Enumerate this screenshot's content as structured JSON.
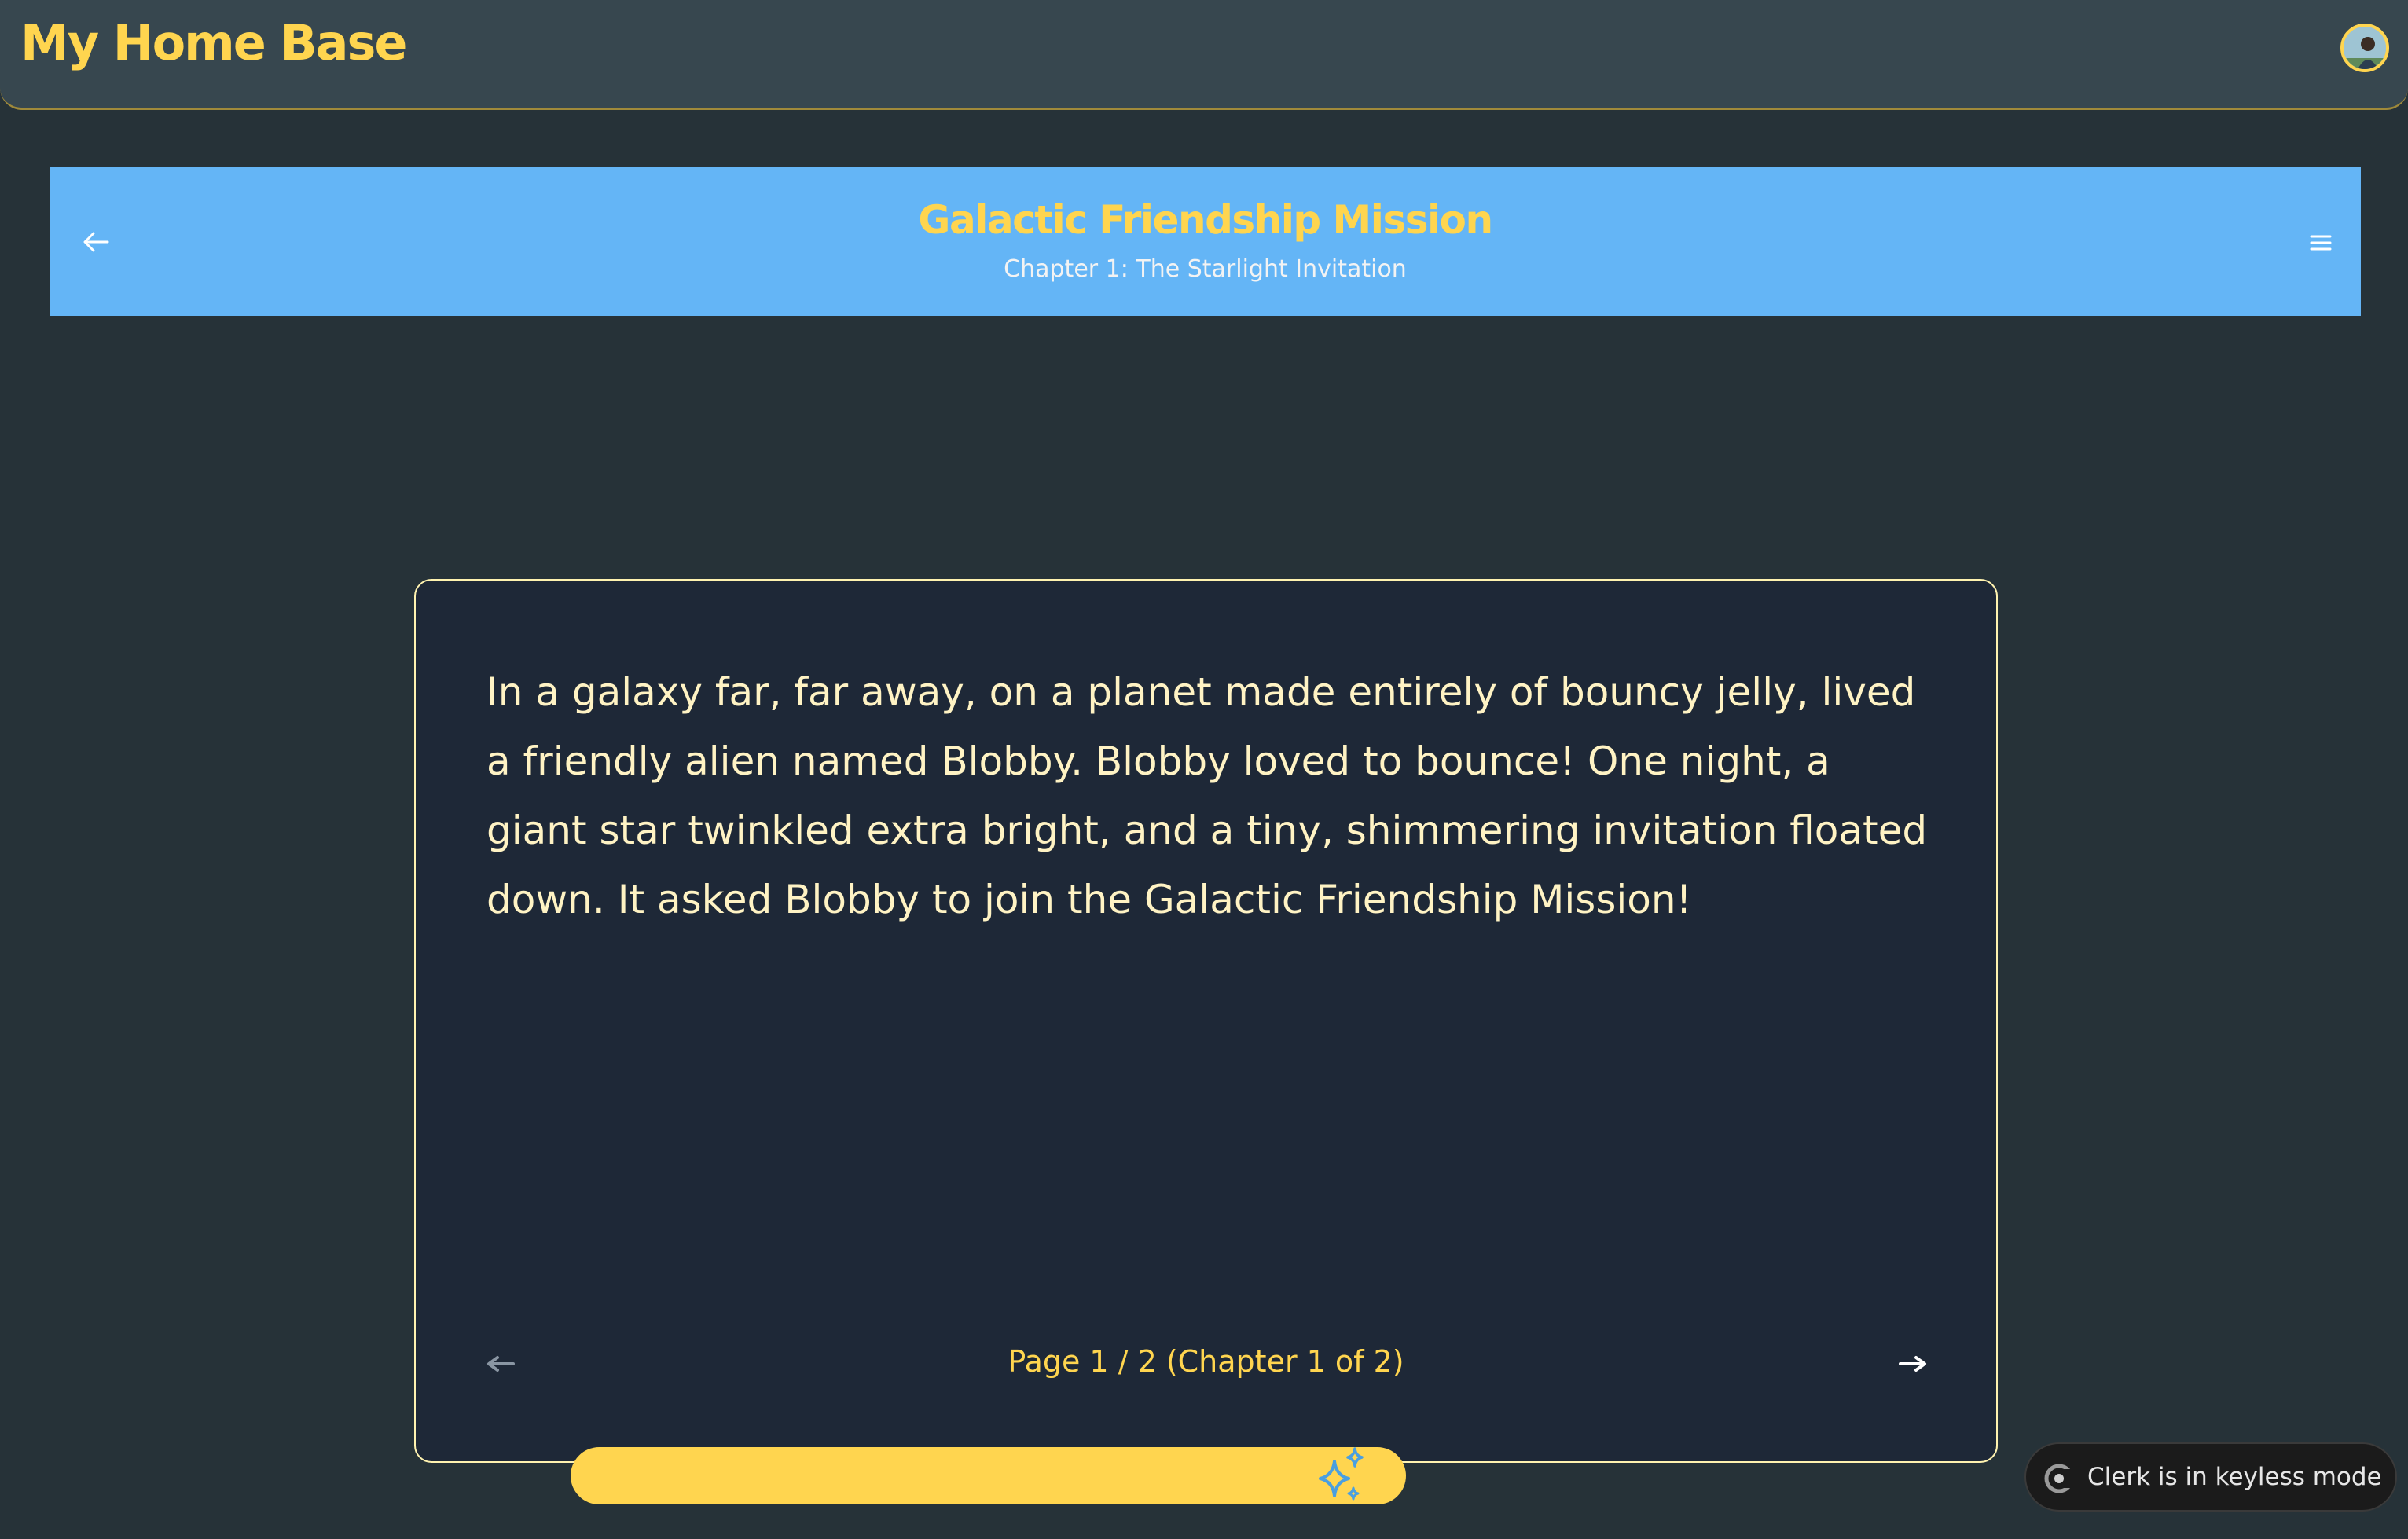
{
  "app": {
    "title": "My Home Base"
  },
  "header": {
    "avatar_icon": "user-avatar"
  },
  "story": {
    "title": "Galactic Friendship Mission",
    "chapter": "Chapter 1: The Starlight Invitation",
    "text": "In a galaxy far, far away, on a planet made entirely of bouncy jelly, lived a friendly alien named Blobby. Blobby loved to bounce! One night, a giant star twinkled extra bright, and a tiny, shimmering invitation floated down. It asked Blobby to join the Galactic Friendship Mission!",
    "page_indicator": "Page 1 / 2 (Chapter 1 of 2)"
  },
  "controls": {
    "back_icon": "arrow-left-icon",
    "menu_icon": "hamburger-menu-icon",
    "prev_icon": "arrow-left-icon",
    "next_icon": "arrow-right-icon",
    "action_icon": "sparkles-icon"
  },
  "clerk": {
    "label": "Clerk is in keyless mode"
  },
  "colors": {
    "background": "#263238",
    "topbar": "#37474f",
    "accent": "#ffd54f",
    "banner": "#64b5f6",
    "card": "#1e2837",
    "story_text": "#fff3c4"
  }
}
